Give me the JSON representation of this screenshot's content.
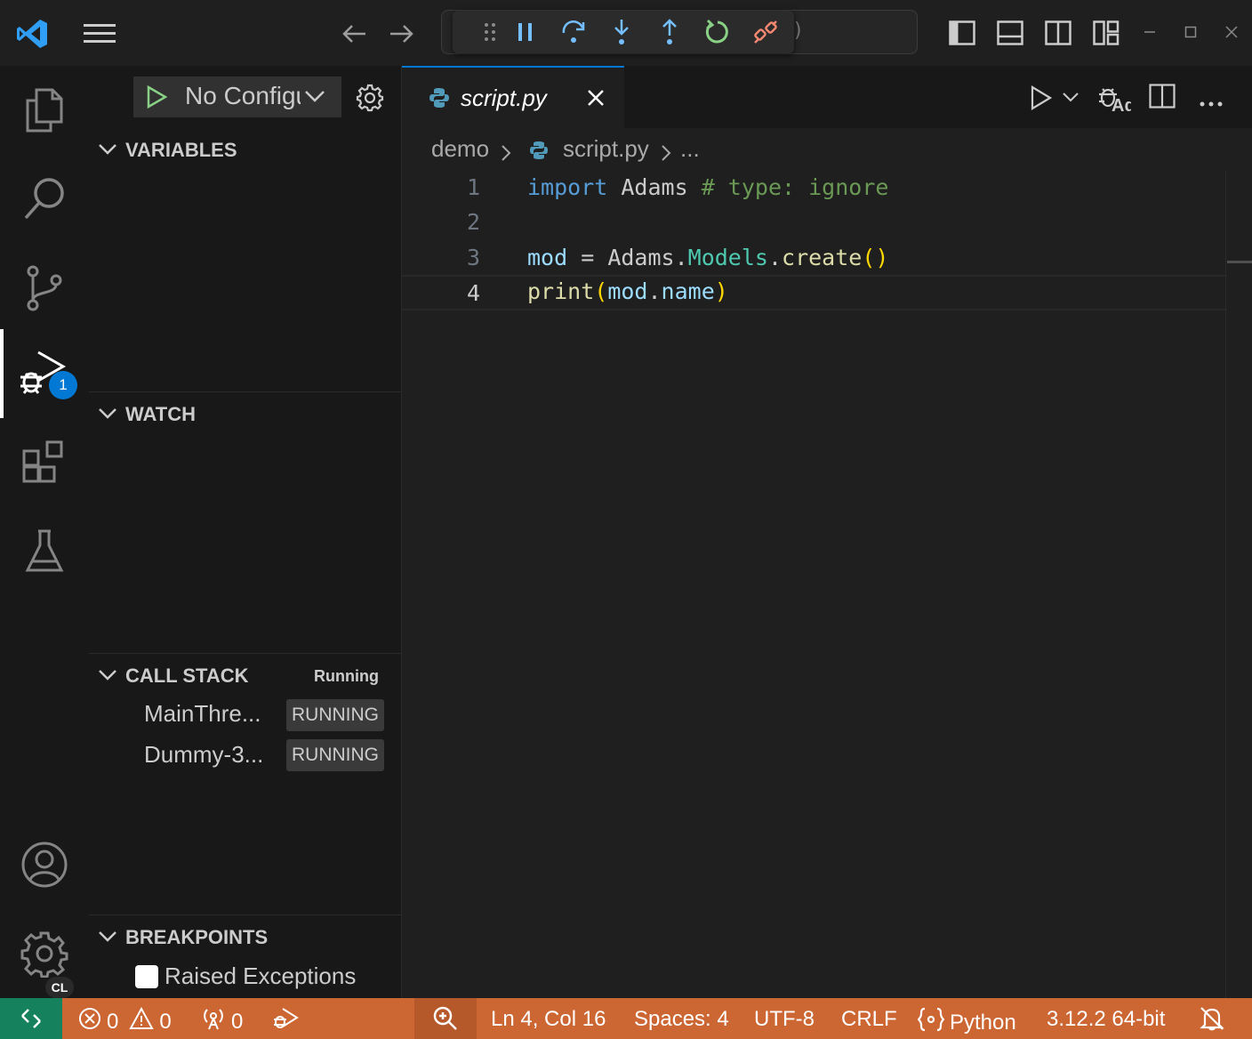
{
  "titlebar": {
    "icons": [
      "vscode-logo-icon",
      "menu-icon",
      "back-arrow-icon",
      "forward-arrow-icon",
      "layout-sidebar-icon",
      "layout-panel-icon",
      "layout-secondary-icon",
      "customize-layout-icon",
      "minimize-icon",
      "maximize-icon",
      "close-icon"
    ],
    "search_fragment": ")"
  },
  "debug_toolbar": {
    "buttons": [
      "drag-handle-icon",
      "pause-icon",
      "step-over-icon",
      "step-into-icon",
      "step-out-icon",
      "restart-icon",
      "disconnect-icon"
    ]
  },
  "activitybar": {
    "items": [
      "explorer-icon",
      "search-icon",
      "source-control-icon",
      "run-debug-icon",
      "extensions-icon",
      "testing-icon"
    ],
    "debug_badge": "1",
    "account_icon": "account-icon",
    "settings_badge": "CL"
  },
  "sidebar": {
    "run_config_label": "No Configurations",
    "variables_title": "VARIABLES",
    "watch_title": "WATCH",
    "callstack_title": "CALL STACK",
    "callstack_status": "Running",
    "threads": [
      {
        "name": "MainThre...",
        "state": "RUNNING"
      },
      {
        "name": "Dummy-3...",
        "state": "RUNNING"
      }
    ],
    "breakpoints_title": "BREAKPOINTS",
    "breakpoint_items": [
      {
        "label": "Raised Exceptions",
        "checked": false
      }
    ]
  },
  "editor": {
    "tab_name": "script.py",
    "breadcrumb": [
      "demo",
      "script.py",
      "..."
    ],
    "lines": [
      {
        "num": "1"
      },
      {
        "num": "2"
      },
      {
        "num": "3"
      },
      {
        "num": "4"
      }
    ],
    "tokens": {
      "l1_import": "import",
      "l1_module": "Adams",
      "l1_comment": "# type: ignore",
      "l3_var": "mod",
      "l3_eq": " = ",
      "l3_module": "Adams",
      "l3_dot1": ".",
      "l3_class": "Models",
      "l3_dot2": ".",
      "l3_fn": "create",
      "l3_parens": "()",
      "l4_fn": "print",
      "l4_open": "(",
      "l4_obj": "mod",
      "l4_dot": ".",
      "l4_attr": "name",
      "l4_close": ")"
    }
  },
  "statusbar": {
    "errors": "0",
    "warnings": "0",
    "ports": "0",
    "position": "Ln 4, Col 16",
    "spaces": "Spaces: 4",
    "encoding": "UTF-8",
    "eol": "CRLF",
    "language": "Python",
    "interpreter": "3.12.2 64-bit"
  }
}
